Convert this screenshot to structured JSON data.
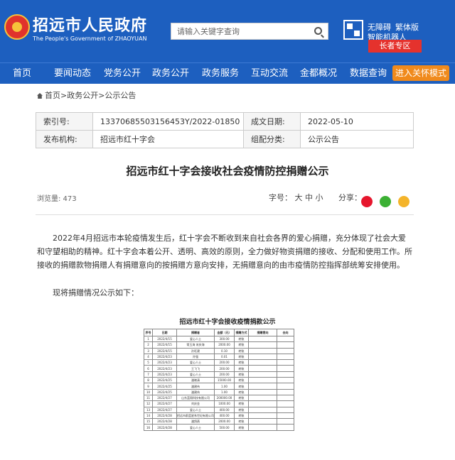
{
  "header": {
    "site_name": "招远市人民政府",
    "site_name_en": "The People's Government of ZHAOYUAN",
    "search_placeholder": "请输入关键字查询",
    "accessibility": "无障碍",
    "traditional": "繁体版",
    "robot": "智能机器人",
    "elder_zone": "长者专区"
  },
  "nav": {
    "items": [
      "首页",
      "要闻动态",
      "党务公开",
      "政务公开",
      "政务服务",
      "互动交流",
      "金都概况",
      "数据查询"
    ],
    "care_mode": "进入关怀模式"
  },
  "breadcrumb": "首页>政务公开>公示公告",
  "meta": {
    "index_label": "索引号:",
    "index_value": "13370685503156453Y/2022-01850",
    "date_label": "成文日期:",
    "date_value": "2022-05-10",
    "publisher_label": "发布机构:",
    "publisher_value": "招远市红十字会",
    "category_label": "组配分类:",
    "category_value": "公示公告"
  },
  "article": {
    "title": "招远市红十字会接收社会疫情防控捐赠公示",
    "views": "浏览量: 473",
    "font_size": "字号： 大 中 小",
    "share": "分享：",
    "para1": "2022年4月招远市本轮疫情发生后，红十字会不断收到来自社会各界的爱心捐赠，充分体现了社会大爱和守望相助的精神。红十字会本着公开、透明、高效的原则，全力做好物资捐赠的接收、分配和使用工作。所接收的捐赠款物捐赠人有捐赠意向的按捐赠方意向安排，无捐赠意向的由市疫情防控指挥部统筹安排使用。",
    "para2": "现将捐赠情况公示如下："
  },
  "donation_table": {
    "title": "招远市红十字会接收疫情捐款公示",
    "headers": [
      "序号",
      "日期",
      "捐赠者",
      "金额（元）",
      "捐赠方式",
      "捐赠意向",
      "去向"
    ],
    "rows": [
      [
        "1",
        "2022/4/15",
        "爱心人士",
        "300.00",
        "转账",
        "",
        ""
      ],
      [
        "2",
        "2022/4/15",
        "常玉海 宋庆海",
        "2000.00",
        "转账",
        "",
        ""
      ],
      [
        "3",
        "2022/4/15",
        "孙旺建",
        "0.10",
        "转账",
        "",
        ""
      ],
      [
        "4",
        "2022/4/23",
        "孙强",
        "0.01",
        "转账",
        "",
        ""
      ],
      [
        "5",
        "2022/4/23",
        "爱心人士",
        "200.00",
        "转账",
        "",
        ""
      ],
      [
        "6",
        "2022/4/23",
        "王飞飞",
        "200.00",
        "转账",
        "",
        ""
      ],
      [
        "7",
        "2022/4/23",
        "爱心人士",
        "200.00",
        "转账",
        "",
        ""
      ],
      [
        "8",
        "2022/4/25",
        "潘晓清",
        "15000.00",
        "转账",
        "",
        ""
      ],
      [
        "9",
        "2022/4/25",
        "潘建伟",
        "1.00",
        "转账",
        "",
        ""
      ],
      [
        "10",
        "2022/4/25",
        "潘建伟",
        "1.00",
        "转账",
        "",
        ""
      ],
      [
        "11",
        "2022/4/27",
        "山东蓝翔科技有限公司",
        "200000.00",
        "转账",
        "",
        ""
      ],
      [
        "12",
        "2022/4/27",
        "刘庆金",
        "1000.00",
        "转账",
        "",
        ""
      ],
      [
        "13",
        "2022/4/27",
        "爱心人士",
        "400.00",
        "转账",
        "",
        ""
      ],
      [
        "14",
        "2022/4/28",
        "招远市蔚蓝星系世纪有限公司",
        "400.00",
        "转账",
        "",
        ""
      ],
      [
        "15",
        "2022/4/28",
        "潘鸽燕",
        "2000.00",
        "转账",
        "",
        ""
      ],
      [
        "16",
        "2022/4/28",
        "爱心人士",
        "500.00",
        "转账",
        "",
        ""
      ]
    ]
  }
}
